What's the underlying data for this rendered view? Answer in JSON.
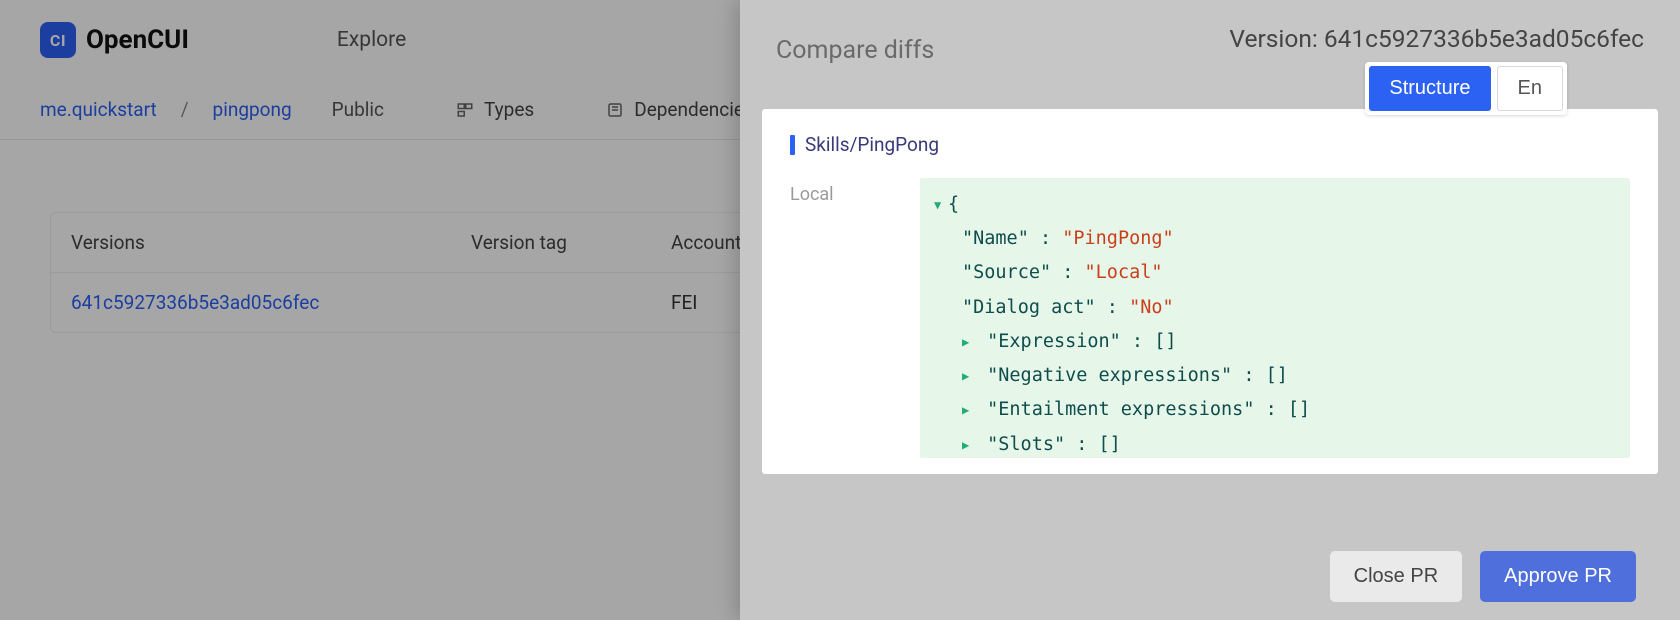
{
  "brand": {
    "logo_text": "CI",
    "name": "OpenCUI"
  },
  "nav": {
    "explore": "Explore"
  },
  "breadcrumb": {
    "org": "me.quickstart",
    "sep": "/",
    "project": "pingpong",
    "visibility": "Public"
  },
  "tabs": {
    "types": "Types",
    "dependencies": "Dependencies"
  },
  "versions_table": {
    "headers": {
      "versions": "Versions",
      "version_tag": "Version tag",
      "account": "Account"
    },
    "rows": [
      {
        "id": "641c5927336b5e3ad05c6fec",
        "tag": "",
        "account": "FEI"
      }
    ]
  },
  "panel": {
    "version_label": "Version: ",
    "version_value": "641c5927336b5e3ad05c6fec",
    "title": "Compare diffs",
    "tab_structure": "Structure",
    "tab_en": "En",
    "skill_path": "Skills/PingPong",
    "diff_label": "Local",
    "code": {
      "open": "{",
      "l1_key": "\"Name\"",
      "l1_val": "\"PingPong\"",
      "l2_key": "\"Source\"",
      "l2_val": "\"Local\"",
      "l3_key": "\"Dialog act\"",
      "l3_val": "\"No\"",
      "l4_key": "\"Expression\"",
      "l4_val": "[]",
      "l5_key": "\"Negative expressions\"",
      "l5_val": "[]",
      "l6_key": "\"Entailment expressions\"",
      "l6_val": "[]",
      "l7_key": "\"Slots\"",
      "l7_val": "[]"
    },
    "btn_close": "Close PR",
    "btn_approve": "Approve PR"
  }
}
